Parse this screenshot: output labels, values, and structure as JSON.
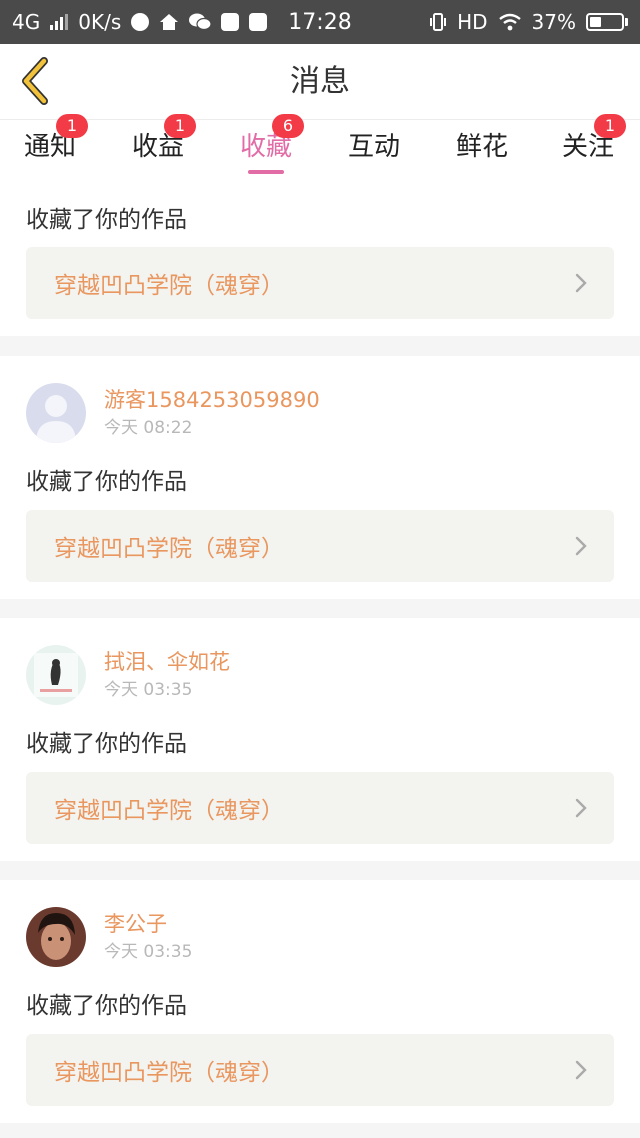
{
  "statusbar": {
    "network": "4G",
    "speed": "0K/s",
    "time": "17:28",
    "hd": "HD",
    "battery_text": "37%",
    "battery_level": 0.37
  },
  "nav": {
    "title": "消息"
  },
  "tabs": [
    {
      "label": "通知",
      "badge": "1"
    },
    {
      "label": "收益",
      "badge": "1"
    },
    {
      "label": "收藏",
      "badge": "6",
      "active": true
    },
    {
      "label": "互动"
    },
    {
      "label": "鲜花"
    },
    {
      "label": "关注",
      "badge": "1"
    }
  ],
  "items": [
    {
      "action": "收藏了你的作品",
      "work": "穿越凹凸学院（魂穿）"
    },
    {
      "user": "游客1584253059890",
      "time": "今天 08:22",
      "avatar": "default-avatar",
      "action": "收藏了你的作品",
      "work": "穿越凹凸学院（魂穿）"
    },
    {
      "user": "拭泪、伞如花",
      "time": "今天 03:35",
      "avatar": "photo-avatar",
      "action": "收藏了你的作品",
      "work": "穿越凹凸学院（魂穿）"
    },
    {
      "user": "李公子",
      "time": "今天 03:35",
      "avatar": "photo-avatar",
      "action": "收藏了你的作品",
      "work": "穿越凹凸学院（魂穿）"
    }
  ],
  "colors": {
    "accent": "#e26ca6",
    "badge": "#f23b47",
    "username": "#e9965f",
    "back_arrow": "#f2c23a"
  }
}
